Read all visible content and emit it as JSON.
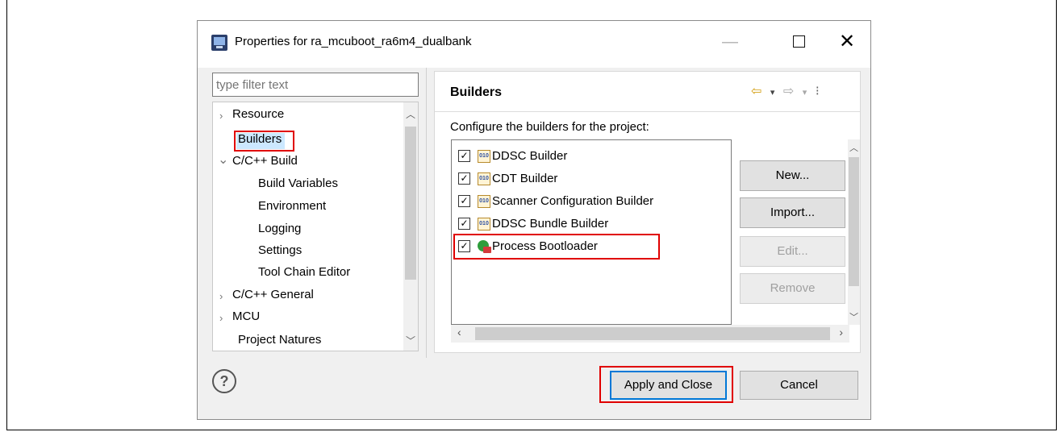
{
  "window": {
    "title": "Properties for ra_mcuboot_ra6m4_dualbank",
    "minimize_glyph": "—",
    "close_glyph": "✕"
  },
  "filter": {
    "placeholder": "type filter text"
  },
  "tree": {
    "items": [
      {
        "label": "Resource",
        "expander": "›"
      },
      {
        "label": "Builders",
        "selected": true
      },
      {
        "label": "C/C++ Build",
        "expander": "⌄"
      },
      {
        "label": "Build Variables"
      },
      {
        "label": "Environment"
      },
      {
        "label": "Logging"
      },
      {
        "label": "Settings"
      },
      {
        "label": "Tool Chain Editor"
      },
      {
        "label": "C/C++ General",
        "expander": "›"
      },
      {
        "label": "MCU",
        "expander": "›"
      },
      {
        "label": "Project Natures"
      }
    ]
  },
  "page": {
    "heading": "Builders",
    "description": "Configure the builders for the project:",
    "nav": {
      "back": "⇦",
      "dropdown": "▾",
      "forward": "⇨",
      "menu": "⁝"
    }
  },
  "builders": [
    {
      "label": "DDSC Builder",
      "checked": true,
      "icon": "binary-builder-icon",
      "icon_text": "010"
    },
    {
      "label": "CDT Builder",
      "checked": true,
      "icon": "binary-builder-icon",
      "icon_text": "010"
    },
    {
      "label": "Scanner Configuration Builder",
      "checked": true,
      "icon": "binary-builder-icon",
      "icon_text": "010"
    },
    {
      "label": "DDSC Bundle Builder",
      "checked": true,
      "icon": "binary-builder-icon",
      "icon_text": "010"
    },
    {
      "label": "Process Bootloader",
      "checked": true,
      "icon": "external-tool-builder-icon"
    }
  ],
  "buttons": {
    "new": "New...",
    "import": "Import...",
    "edit": "Edit...",
    "remove": "Remove",
    "apply_close": "Apply and Close",
    "cancel": "Cancel",
    "help": "?"
  },
  "checkmark": "✓",
  "colors": {
    "highlight": "#e00000",
    "selection": "#cce8ff",
    "default_button_border": "#0078d7"
  }
}
